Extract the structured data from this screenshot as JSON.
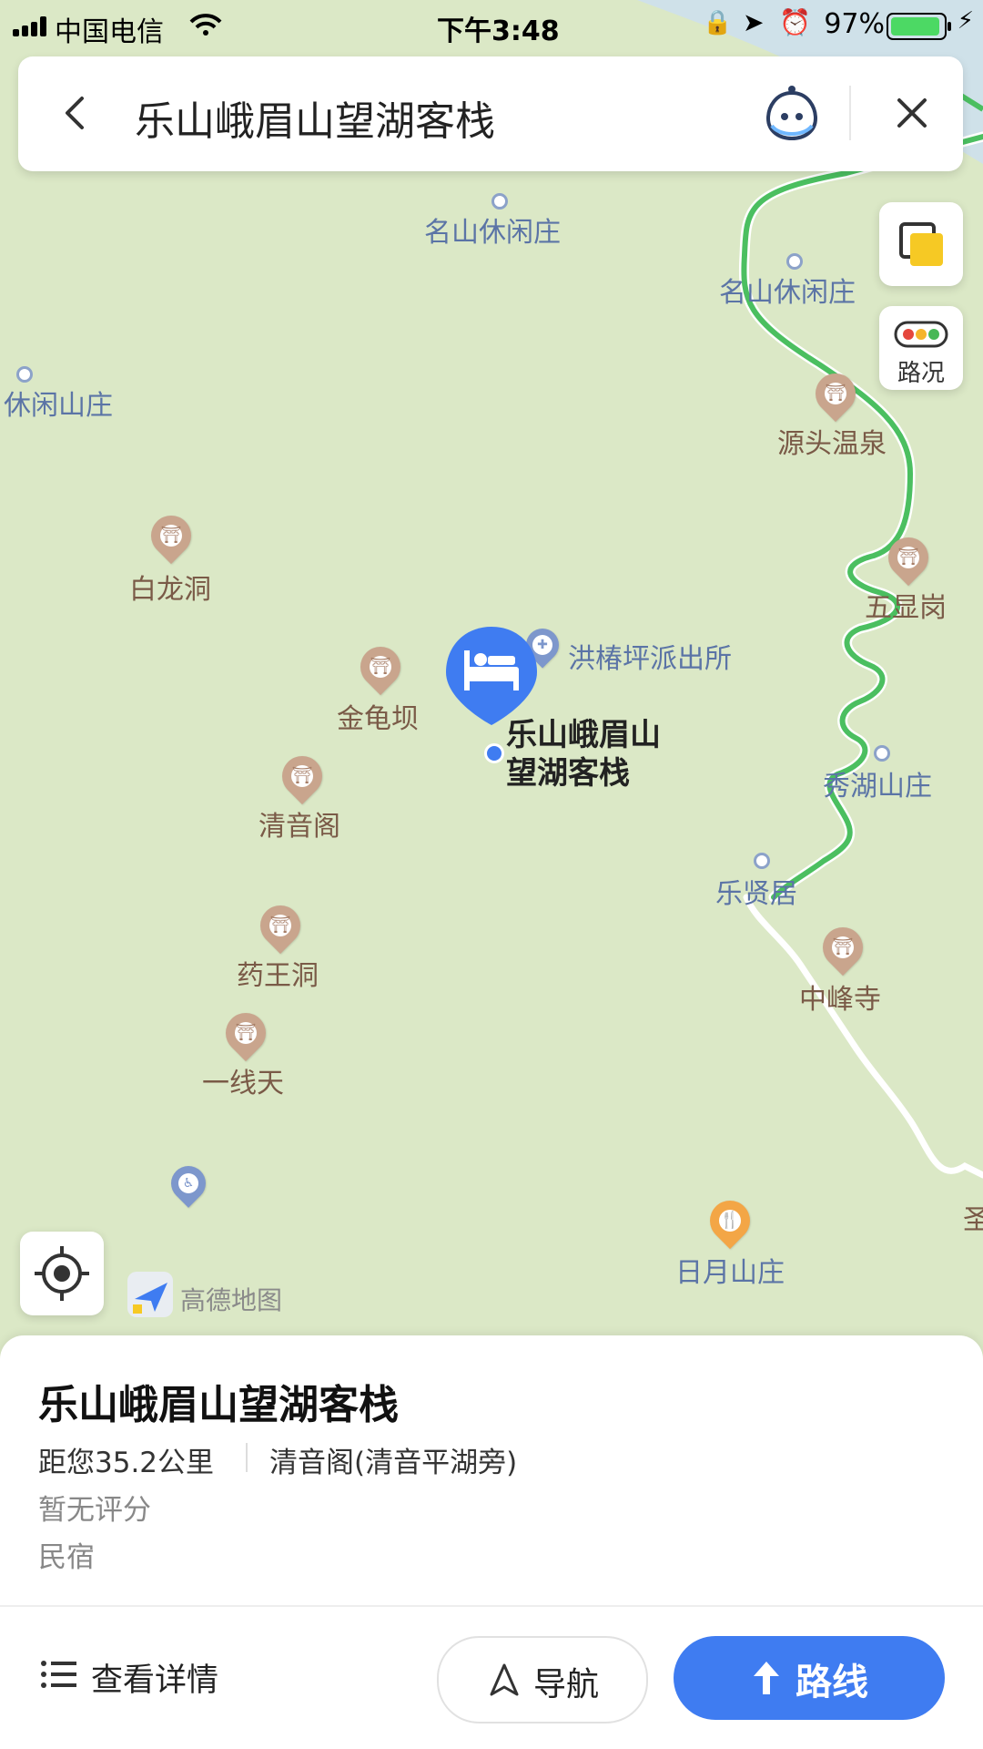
{
  "status_bar": {
    "carrier": "中国电信",
    "time": "下午3:48",
    "battery": "97%"
  },
  "search": {
    "query": "乐山峨眉山望湖客栈",
    "back_icon": "chevron-left-icon",
    "assistant_icon": "assistant-bot-icon",
    "close_icon": "close-icon"
  },
  "map": {
    "pois": [
      {
        "label": "名山休闲庄"
      },
      {
        "label": "名山休闲庄"
      },
      {
        "label": "休闲山庄"
      },
      {
        "label": "源头温泉"
      },
      {
        "label": "白龙洞"
      },
      {
        "label": "五显岗"
      },
      {
        "label": "洪椿坪派出所"
      },
      {
        "label": "金龟坝"
      },
      {
        "label": "清音阁"
      },
      {
        "label": "秀湖山庄"
      },
      {
        "label": "乐贤居"
      },
      {
        "label": "药王洞"
      },
      {
        "label": "中峰寺"
      },
      {
        "label": "一线天"
      },
      {
        "label": "日月山庄"
      },
      {
        "label": "圣"
      }
    ],
    "selected": {
      "label_line1": "乐山峨眉山",
      "label_line2": "望湖客栈",
      "icon": "bed-icon"
    },
    "controls": {
      "traffic_label": "路况"
    },
    "brand": "高德地图",
    "colors": {
      "road_green": "#4bbf60",
      "accent": "#3f7cf1",
      "poi_brown": "#c9a58d"
    }
  },
  "panel": {
    "name": "乐山峨眉山望湖客栈",
    "distance": "距您35.2公里",
    "address": "清音阁(清音平湖旁)",
    "rating": "暂无评分",
    "type": "民宿",
    "details_label": "查看详情",
    "nav_label": "导航",
    "route_label": "路线"
  }
}
